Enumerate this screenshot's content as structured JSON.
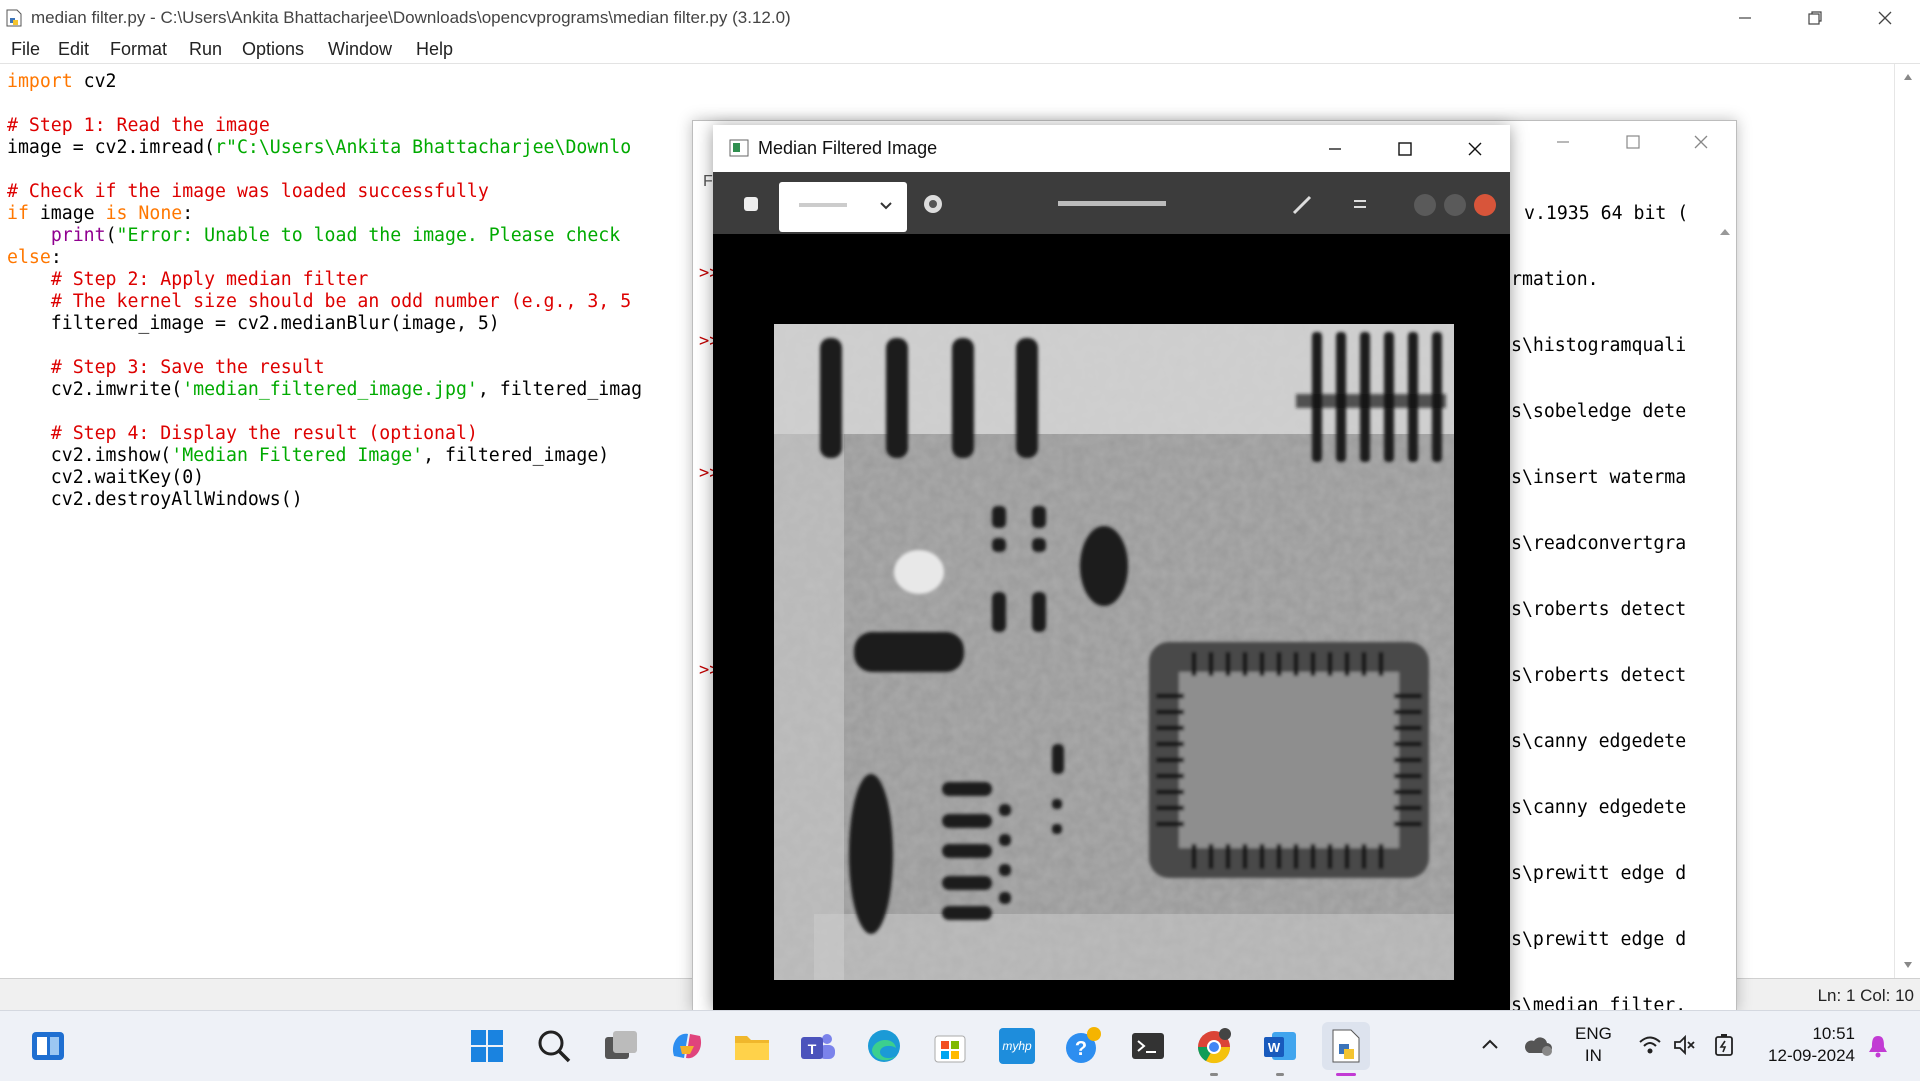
{
  "editor": {
    "title": "median filter.py - C:\\Users\\Ankita Bhattacharjee\\Downloads\\opencvprograms\\median filter.py (3.12.0)",
    "menu": [
      "File",
      "Edit",
      "Format",
      "Run",
      "Options",
      "Window",
      "Help"
    ],
    "code_lines": [
      [
        {
          "t": "import",
          "c": "kw"
        },
        {
          "t": " cv2"
        }
      ],
      [],
      [
        {
          "t": "# Step 1: Read the image",
          "c": "cm"
        }
      ],
      [
        {
          "t": "image = cv2.imread("
        },
        {
          "t": "r\"C:\\Users\\Ankita Bhattacharjee\\Downlo",
          "c": "st"
        }
      ],
      [],
      [
        {
          "t": "# Check if the image was loaded successfully",
          "c": "cm"
        }
      ],
      [
        {
          "t": "if",
          "c": "kw"
        },
        {
          "t": " image "
        },
        {
          "t": "is",
          "c": "kw"
        },
        {
          "t": " "
        },
        {
          "t": "None",
          "c": "kw"
        },
        {
          "t": ":"
        }
      ],
      [
        {
          "t": "    "
        },
        {
          "t": "print",
          "c": "bi"
        },
        {
          "t": "("
        },
        {
          "t": "\"Error: Unable to load the image. Please check",
          "c": "st"
        }
      ],
      [
        {
          "t": "else",
          "c": "kw"
        },
        {
          "t": ":"
        }
      ],
      [
        {
          "t": "    "
        },
        {
          "t": "# Step 2: Apply median filter",
          "c": "cm"
        }
      ],
      [
        {
          "t": "    "
        },
        {
          "t": "# The kernel size should be an odd number (e.g., 3, 5",
          "c": "cm"
        }
      ],
      [
        {
          "t": "    filtered_image = cv2.medianBlur(image, 5)"
        }
      ],
      [],
      [
        {
          "t": "    "
        },
        {
          "t": "# Step 3: Save the result",
          "c": "cm"
        }
      ],
      [
        {
          "t": "    cv2.imwrite("
        },
        {
          "t": "'median_filtered_image.jpg'",
          "c": "st"
        },
        {
          "t": ", filtered_imag"
        }
      ],
      [],
      [
        {
          "t": "    "
        },
        {
          "t": "# Step 4: Display the result (optional)",
          "c": "cm"
        }
      ],
      [
        {
          "t": "    cv2.imshow("
        },
        {
          "t": "'Median Filtered Image'",
          "c": "st"
        },
        {
          "t": ", filtered_image)"
        }
      ],
      [
        {
          "t": "    cv2.waitKey(0)"
        }
      ],
      [
        {
          "t": "    cv2.destroyAllWindows()"
        }
      ]
    ],
    "status": "Ln: 1   Col: 10"
  },
  "shell": {
    "menu_fragment": "Fi",
    "prompt_symbol": ">>",
    "lines": [
      "v.1935 64 bit (",
      "rmation.",
      "s\\histogramquali",
      "s\\sobeledge dete",
      "s\\insert waterma",
      "s\\readconvertgra",
      "s\\roberts detect",
      "s\\roberts detect",
      "s\\canny edgedete",
      "s\\canny edgedete",
      "s\\prewitt edge d",
      "s\\prewitt edge d",
      "s\\median filter."
    ]
  },
  "image_window": {
    "title": "Median Filtered Image",
    "image_description": "grayscale x-ray image of a circuit board, median filtered"
  },
  "taskbar": {
    "apps": [
      "start-icon",
      "search-icon",
      "task-view-icon",
      "copilot-icon",
      "file-explorer-icon",
      "teams-icon",
      "edge-icon",
      "store-icon",
      "myhp-icon",
      "help-icon",
      "terminal-icon",
      "chrome-icon",
      "word-icon",
      "python-idle-icon"
    ],
    "myhp_label": "myhp",
    "lang_top": "ENG",
    "lang_bottom": "IN",
    "time": "10:51",
    "date": "12-09-2024"
  },
  "colors": {
    "keyword": "#ff7700",
    "comment": "#dd0000",
    "string": "#00aa00",
    "builtin": "#900090"
  }
}
